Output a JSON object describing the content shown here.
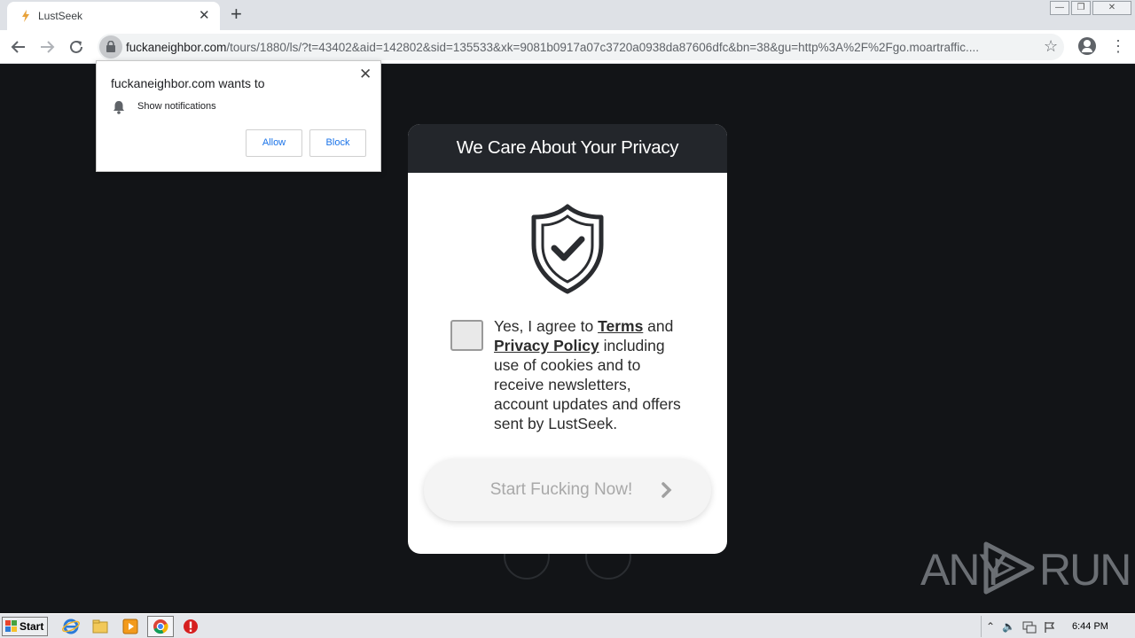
{
  "browser": {
    "tab_title": "LustSeek",
    "tab_close": "✕",
    "new_tab": "+",
    "url_host": "fuckaneighbor.com",
    "url_path": "/tours/1880/ls/?t=43402&aid=142802&sid=135533&xk=9081b0917a07c3720a0938da87606dfc&bn=38&gu=http%3A%2F%2Fgo.moartraffic....",
    "window_min": "—",
    "window_max": "❐",
    "window_close": "✕"
  },
  "notification": {
    "title": "fuckaneighbor.com wants to",
    "permission": "Show notifications",
    "allow_label": "Allow",
    "block_label": "Block",
    "close": "✕"
  },
  "modal": {
    "title": "We Care About Your Privacy",
    "agree_prefix": "Yes, I agree to ",
    "terms_link": "Terms",
    "and_word": " and ",
    "privacy_link": "Privacy Policy",
    "agree_suffix": " including use of cookies and to receive newsletters, account updates and offers sent by LustSeek.",
    "agree_checked": false,
    "start_button": "Start Fucking Now!"
  },
  "watermark": {
    "left": "ANY",
    "right": "RUN"
  },
  "taskbar": {
    "start_label": "Start",
    "clock": "6:44 PM"
  },
  "colors": {
    "modal_header": "#23262b",
    "page_bg": "#121417",
    "link_blue": "#1a73e8"
  }
}
